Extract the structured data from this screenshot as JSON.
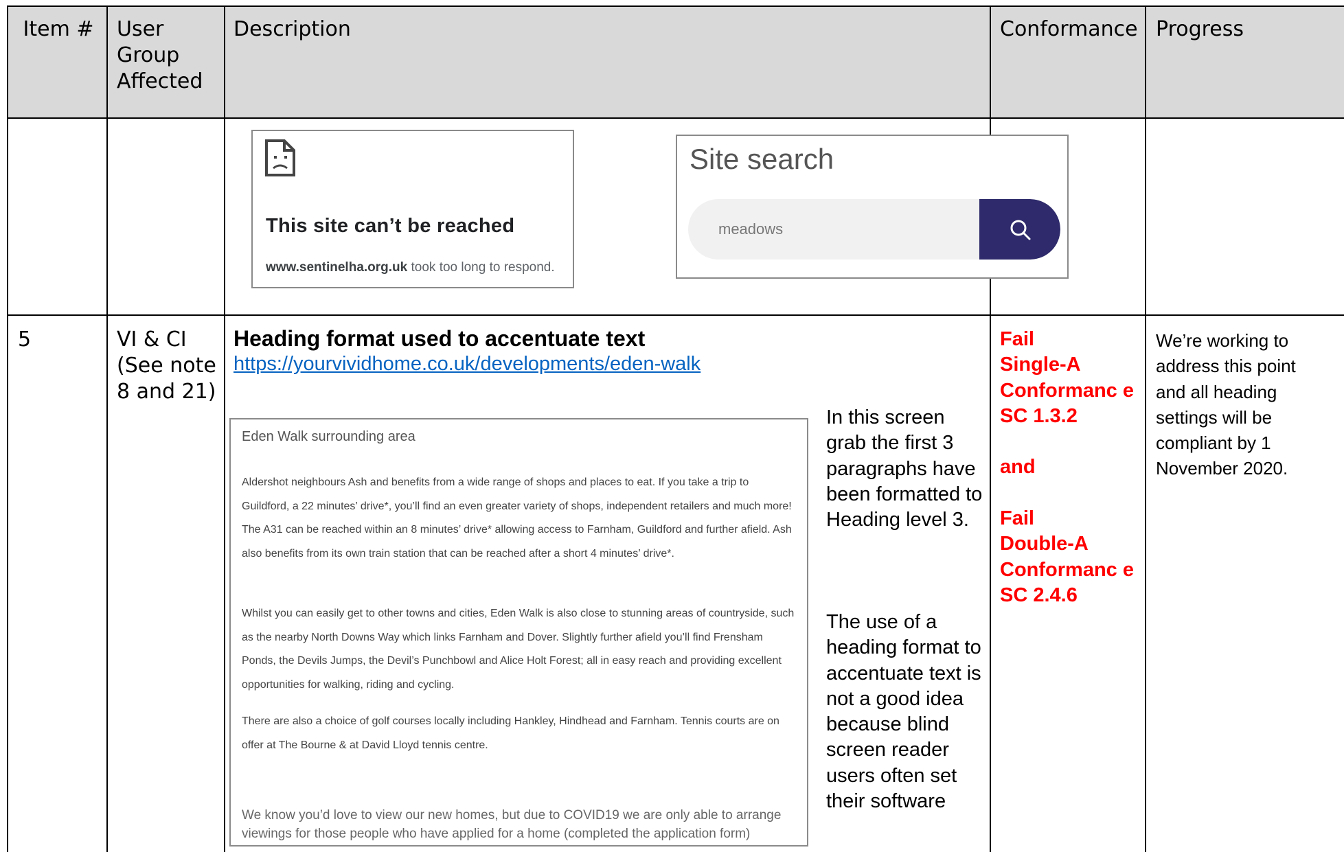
{
  "table": {
    "headers": {
      "item": "Item #",
      "user_group": "User Group Affected",
      "description": "Description",
      "conformance": "Conformance",
      "progress": "Progress"
    }
  },
  "row_prev": {
    "error_page": {
      "icon": "sad-document-icon",
      "title": "This site can’t be reached",
      "domain": "www.sentinelha.org.uk",
      "message": "took too long to respond."
    },
    "site_search": {
      "title": "Site search",
      "value": "meadows",
      "button_icon": "search-icon",
      "button_color": "#2e2a6b"
    }
  },
  "row5": {
    "item": "5",
    "user_group": "VI & CI (See note 8 and 21)",
    "heading": "Heading format used to accentuate text",
    "link": "https://yourvividhome.co.uk/developments/eden-walk",
    "screenshot": {
      "title": "Eden Walk surrounding area",
      "paragraphs": [
        "Aldershot neighbours Ash and benefits from a wide range of shops and places to eat. If you take a trip to Guildford, a 22 minutes’ drive*, you’ll find an even greater variety of shops, independent retailers and much more! The A31 can be reached within an 8 minutes’ drive* allowing access to Farnham, Guildford and further afield. Ash also benefits from its own train station that can be reached after a short 4 minutes’ drive*.",
        "Whilst you can easily get to other towns and cities, Eden Walk is also close to stunning areas of countryside, such as the nearby North Downs Way which links Farnham and Dover. Slightly further afield you’ll find Frensham Ponds, the Devils Jumps, the Devil’s Punchbowl and Alice Holt Forest; all in easy reach and providing excellent opportunities for walking, riding and cycling.",
        "There are also a choice of golf courses locally including Hankley, Hindhead and Farnham. Tennis courts are on offer at The Bourne & at David Lloyd tennis centre.",
        "We know you’d love to view our new homes, but due to COVID19 we are only able to arrange viewings for those people who have applied for a home (completed the application form)"
      ]
    },
    "side_note_1": "In this screen grab the first 3 paragraphs have been formatted to Heading level 3.",
    "side_note_2": "The use of a heading format to accentuate text is not a good idea because blind screen reader users often set their software",
    "conformance": {
      "fail1": "Fail",
      "level1": "Single-A Conformanc e",
      "sc1": "SC 1.3.2",
      "and": "and",
      "fail2": "Fail",
      "level2": "Double-A Conformanc e",
      "sc2": "SC 2.4.6",
      "color": "#ff0000"
    },
    "progress": "We’re working to address this point and all heading settings will be compliant by 1 November 2020."
  }
}
